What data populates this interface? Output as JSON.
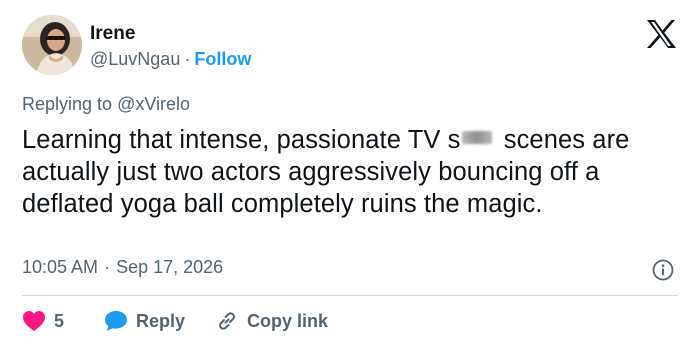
{
  "user": {
    "name": "Irene",
    "handle": "@LuvNgau",
    "separator": "·",
    "follow_label": "Follow"
  },
  "reply_context": {
    "prefix": "Replying to ",
    "mention": "@xVirelo"
  },
  "tweet": {
    "text_before": "Learning that intense, passionate TV s",
    "text_after": " scenes are actually just two actors aggressively bouncing off a deflated yoga ball completely ruins the magic."
  },
  "meta": {
    "time": "10:05 AM",
    "separator": "·",
    "date": "Sep 17, 2026"
  },
  "actions": {
    "like_count": "5",
    "reply_label": "Reply",
    "copy_link_label": "Copy link"
  },
  "colors": {
    "accent": "#1d9bf0",
    "like": "#f91880",
    "secondary_text": "#536471",
    "primary_text": "#0f1419"
  },
  "icons": [
    "x-logo-icon",
    "info-icon",
    "heart-icon",
    "reply-bubble-icon",
    "link-icon"
  ]
}
